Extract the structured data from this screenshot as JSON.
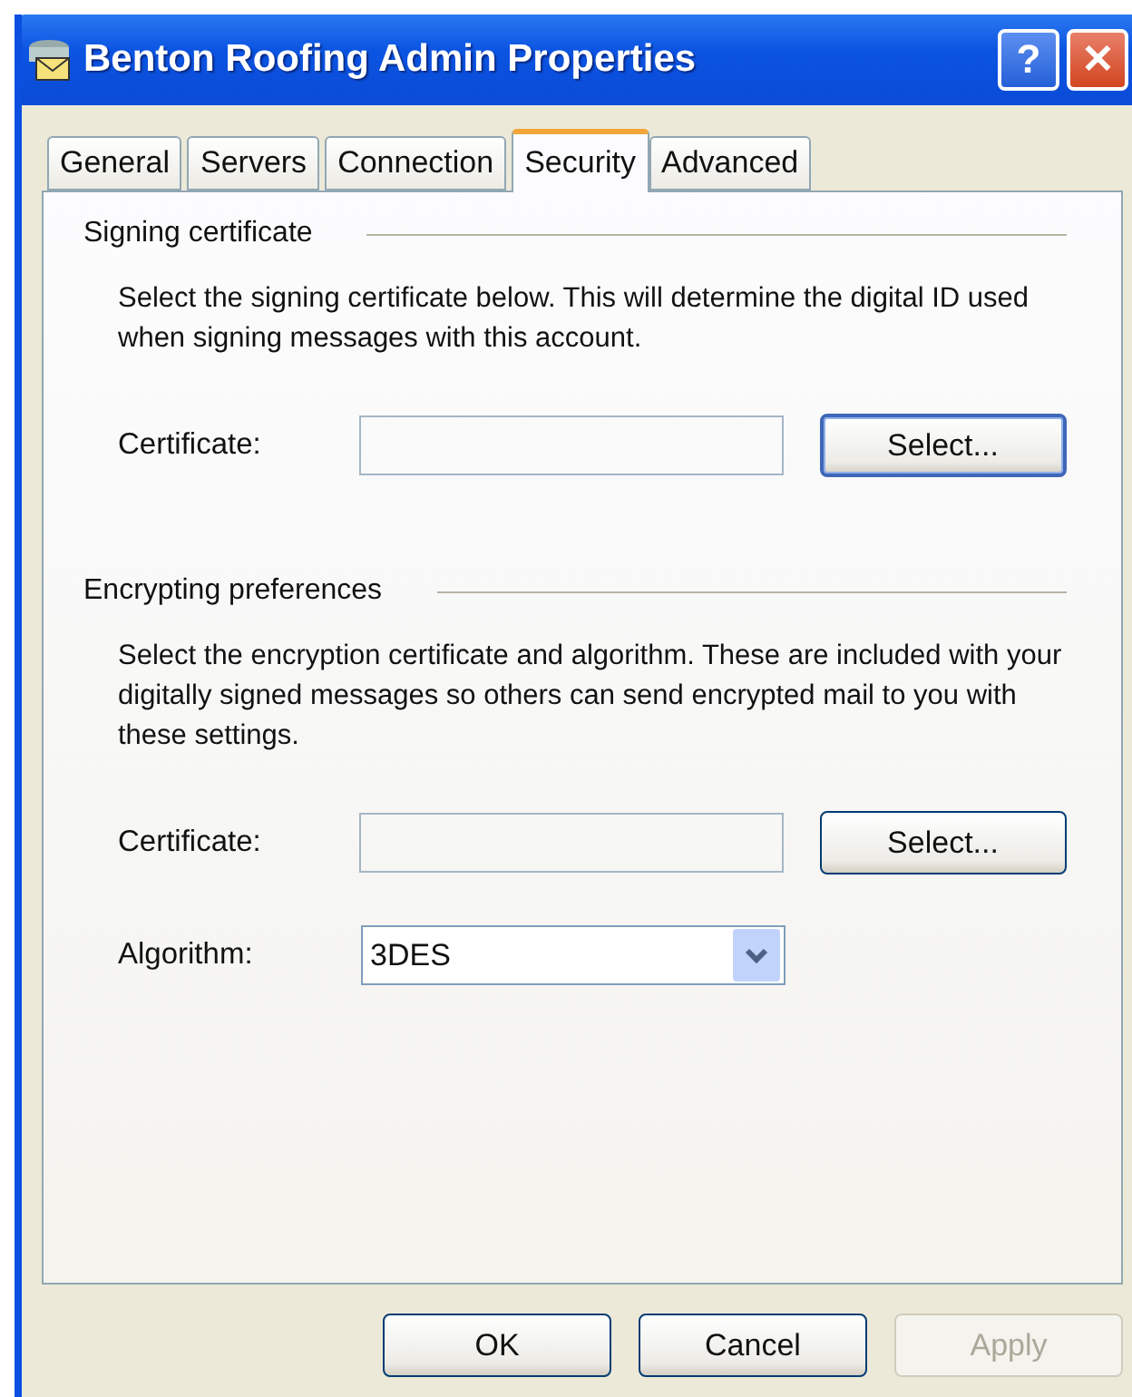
{
  "window": {
    "title": "Benton Roofing Admin Properties"
  },
  "title_buttons": [
    {
      "kind": "help",
      "label": "?"
    },
    {
      "kind": "close",
      "label": "✕"
    }
  ],
  "tabs": [
    {
      "label": "General",
      "selected": false
    },
    {
      "label": "Servers",
      "selected": false
    },
    {
      "label": "Connection",
      "selected": false
    },
    {
      "label": "Security",
      "selected": true
    },
    {
      "label": "Advanced",
      "selected": false
    }
  ],
  "sections": [
    {
      "title": "Signing certificate",
      "description": "Select the signing certificate below. This will determine the digital ID used when signing messages with this account.",
      "rows": [
        {
          "kind": "picker",
          "label": "Certificate:",
          "button": {
            "label": "Select...",
            "default": true
          }
        }
      ]
    },
    {
      "title": "Encrypting preferences",
      "description": "Select the encryption certificate and algorithm. These are included with your digitally signed messages so others can send encrypted mail to you with these settings.",
      "rows": [
        {
          "kind": "picker",
          "label": "Certificate:",
          "button": {
            "label": "Select...",
            "default": false
          }
        },
        {
          "kind": "dropdown",
          "label": "Algorithm:",
          "value": "3DES"
        }
      ]
    }
  ],
  "buttons": [
    {
      "label": "OK",
      "disabled": false
    },
    {
      "label": "Cancel",
      "disabled": false
    },
    {
      "label": "Apply",
      "disabled": true
    }
  ]
}
